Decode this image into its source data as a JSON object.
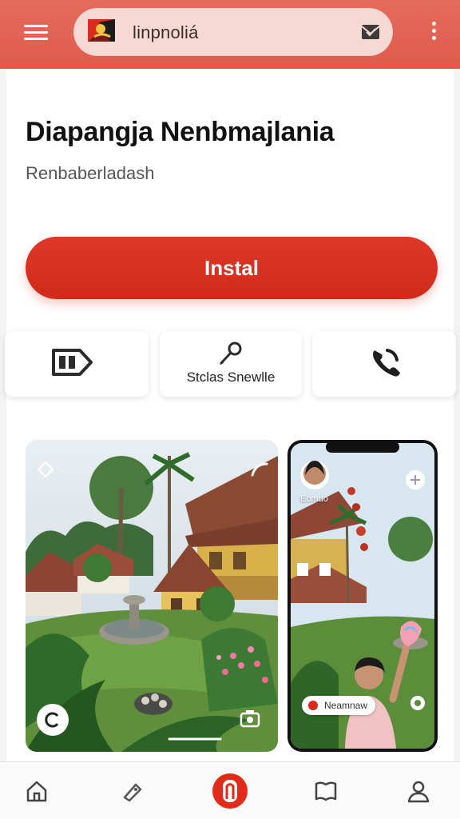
{
  "topbar": {
    "search_text": "linpnoliá",
    "icons": [
      "menu-icon",
      "flag-icon",
      "mail-icon",
      "more-vert-icon"
    ],
    "color": "#e0604f"
  },
  "app": {
    "title": "Diapangja Nenbmajlania",
    "subtitle": "Renbaberladash"
  },
  "install": {
    "label": "Instal",
    "color": "#d9301f"
  },
  "tiles": [
    {
      "icon": "tag-icon",
      "label": ""
    },
    {
      "icon": "pencil-icon",
      "label": "Stclas Snewlle"
    },
    {
      "icon": "phone-icon",
      "label": ""
    }
  ],
  "screenshots": {
    "second": {
      "profile_name": "Ebmdo",
      "caption": "Neamnaw"
    }
  },
  "bottom_nav": [
    {
      "icon": "home-icon"
    },
    {
      "icon": "label-icon"
    },
    {
      "icon": "center-app-icon"
    },
    {
      "icon": "book-icon"
    },
    {
      "icon": "profile-icon"
    }
  ]
}
